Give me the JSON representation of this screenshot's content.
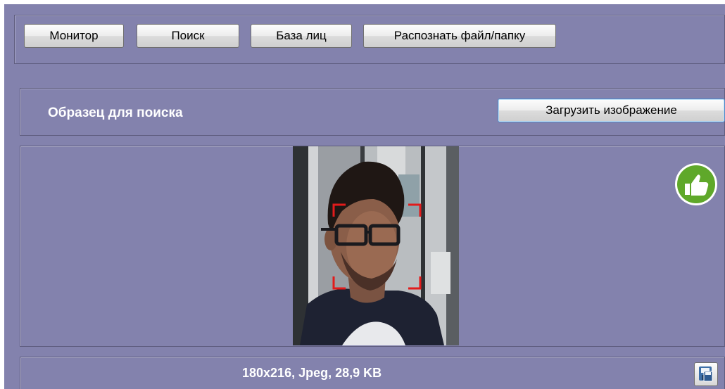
{
  "toolbar": {
    "buttons": [
      {
        "label": "Монитор"
      },
      {
        "label": "Поиск"
      },
      {
        "label": "База лиц"
      },
      {
        "label": "Распознать файл/папку"
      }
    ]
  },
  "search_sample": {
    "title": "Образец для поиска",
    "upload_button": "Загрузить изображение"
  },
  "image_info": {
    "text": "180x216, Jpeg, 28,9 KB"
  },
  "icons": {
    "match": "thumbs-up-icon",
    "save": "save-icon"
  },
  "colors": {
    "background": "#8382ad",
    "match_green": "#5fa82a",
    "detection_frame": "#e21b1b"
  }
}
